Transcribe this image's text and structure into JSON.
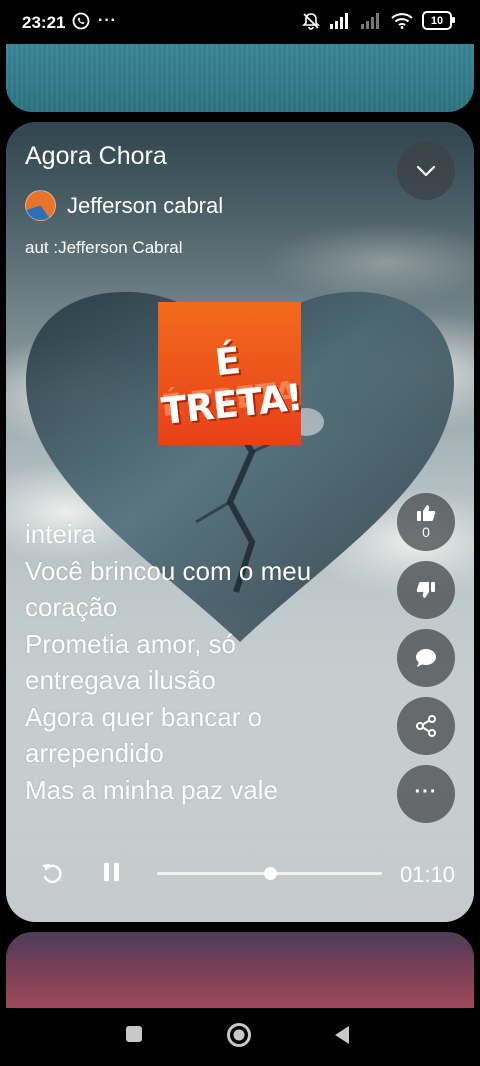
{
  "status_bar": {
    "time": "23:21",
    "left_icons": [
      "whatsapp-icon",
      "more-notifications-icon"
    ],
    "more_label": "···",
    "right_icons": [
      "mute-icon",
      "signal-icon",
      "signal-2-icon",
      "wifi-icon"
    ],
    "battery": "10"
  },
  "song": {
    "title": "Agora Chora",
    "artist": "Jefferson cabral",
    "author": "aut :Jefferson Cabral",
    "cover_text": "É TRETA!",
    "cover_echo": "É TRETA"
  },
  "lyrics": [
    "inteira",
    "Você brincou com o meu",
    "coração",
    "Prometia amor, só",
    "entregava ilusão",
    "Agora quer bancar o",
    "arrependido",
    "Mas a minha paz vale"
  ],
  "actions": {
    "like_count": "0",
    "icons": [
      "thumbs-up-icon",
      "thumbs-down-icon",
      "comment-icon",
      "share-icon",
      "more-icon"
    ],
    "more_label": "···"
  },
  "player": {
    "elapsed": "01:10",
    "progress_fraction": 0.5,
    "state": "playing"
  },
  "colors": {
    "accent_orange": "#ef5a1a",
    "button_bg": "#46484a"
  }
}
